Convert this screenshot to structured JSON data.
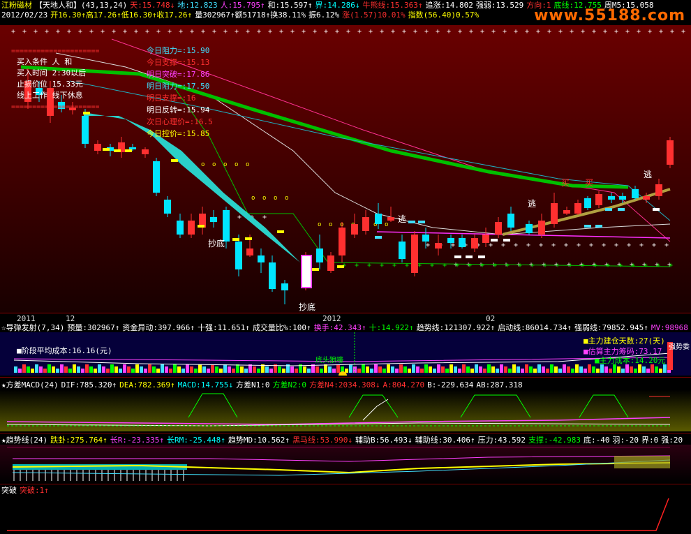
{
  "header": {
    "line1": [
      {
        "t": "江粉磁材",
        "c": "#ffff00"
      },
      {
        "t": "【天地人和】(43,13,24)",
        "c": "#ffffff"
      },
      {
        "t": "天:15.748↓",
        "c": "#ff3030"
      },
      {
        "t": "地:12.823",
        "c": "#40e0ff"
      },
      {
        "t": "人:15.795↑",
        "c": "#ff40ff"
      },
      {
        "t": "和:15.597↑",
        "c": "#ffffff"
      },
      {
        "t": "界:14.286↓",
        "c": "#00ffff"
      },
      {
        "t": "牛熊线:15.363↑",
        "c": "#ff3030"
      },
      {
        "t": "追涨:14.802",
        "c": "#ffffff"
      },
      {
        "t": "强弱:13.529",
        "c": "#ffffff"
      },
      {
        "t": "方向:1",
        "c": "#ff3030"
      },
      {
        "t": "底线:12.755",
        "c": "#00ff00"
      },
      {
        "t": "周M5:15.058",
        "c": "#ffffff"
      }
    ],
    "line2": [
      {
        "t": "2012/02/23",
        "c": "#ffffff"
      },
      {
        "t": "开16.30↑高17.26↑低16.30↑收17.26↑",
        "c": "#ffff00"
      },
      {
        "t": "量302967↑额51718↑换38.11%",
        "c": "#ffffff"
      },
      {
        "t": "振6.12%",
        "c": "#ffffff"
      },
      {
        "t": "涨(1.57)10.01%",
        "c": "#ff3030"
      },
      {
        "t": "指数(56.40)0.57%",
        "c": "#ffff00"
      }
    ]
  },
  "watermark": "www.55188.com",
  "main_chart": {
    "legend_left": [
      "买入条件  人 和",
      "买入时间  2:30以后",
      "止损价位  15.33元",
      "线上工作  线下休息"
    ],
    "legend_right": [
      {
        "t": "今日阻力=:15.90",
        "c": "#40e0ff"
      },
      {
        "t": "今日支撑=:15.13",
        "c": "#ff3030"
      },
      {
        "t": "明日突破=:17.86",
        "c": "#ff40ff"
      },
      {
        "t": "明日阻力=:17.50",
        "c": "#40e0ff"
      },
      {
        "t": "明日支撑=:16",
        "c": "#ff3030"
      },
      {
        "t": "明日反转=:15.94",
        "c": "#ffffff"
      },
      {
        "t": "次日心理价=:16.5",
        "c": "#ff3030"
      },
      {
        "t": "今日控价=:15.85",
        "c": "#ffff00"
      }
    ],
    "annotations": {
      "chaodi1": "抄底",
      "chaodi2": "抄底",
      "tao1": "逃",
      "tao2": "逃",
      "tao3": "逃",
      "mai1": "买",
      "mai2": "买"
    },
    "time_axis": [
      "2011",
      "12",
      "2012",
      "02"
    ]
  },
  "ind1": {
    "title": [
      {
        "t": "☆导弹发射(7,34)",
        "c": "#ffffff"
      },
      {
        "t": "预量:302967↑",
        "c": "#ffffff"
      },
      {
        "t": "资金异动:397.966↑",
        "c": "#ffffff"
      },
      {
        "t": "十强:11.651↑",
        "c": "#ffffff"
      },
      {
        "t": "成交量比%:100↑",
        "c": "#ffffff"
      },
      {
        "t": "换手:42.343↑",
        "c": "#ff40ff"
      },
      {
        "t": "十:14.922↑",
        "c": "#00ff00"
      },
      {
        "t": "趋势线:121307.922↑",
        "c": "#ffffff"
      },
      {
        "t": "启动线:86014.734↑",
        "c": "#ffffff"
      },
      {
        "t": "强弱线:79852.945↑",
        "c": "#ffffff"
      },
      {
        "t": "MV:98968",
        "c": "#ff40ff"
      }
    ],
    "avg_cost": "■阶段平均成本:16.16(元)",
    "right_labels": [
      {
        "t": "■主力建仓天数:27(天)",
        "c": "#ffff00"
      },
      {
        "t": "■估算主力筹码:73.17",
        "c": "#ff40ff"
      },
      {
        "t": "■主力成本:14.20元",
        "c": "#00ff00"
      }
    ],
    "side_text": "强势委",
    "center_text": "底头狼嚎"
  },
  "ind2": {
    "title": [
      {
        "t": "★方差MACD(24)",
        "c": "#ffffff"
      },
      {
        "t": "DIF:785.320↑",
        "c": "#ffffff"
      },
      {
        "t": "DEA:782.369↑",
        "c": "#ffff00"
      },
      {
        "t": "MACD:14.755↓",
        "c": "#00ffff"
      },
      {
        "t": "方差N1:0",
        "c": "#ffffff"
      },
      {
        "t": "方差N2:0",
        "c": "#00ff00"
      },
      {
        "t": "方差N4:2034.308↓",
        "c": "#ff3030"
      },
      {
        "t": "A:804.270",
        "c": "#ff3030"
      },
      {
        "t": "B:-229.634",
        "c": "#ffffff"
      },
      {
        "t": "AB:287.318",
        "c": "#ffffff"
      }
    ]
  },
  "ind3": {
    "title": [
      {
        "t": "★趋势线(24)",
        "c": "#ffffff"
      },
      {
        "t": "跌卦:275.764↑",
        "c": "#ffff00"
      },
      {
        "t": "长R:-23.335↑",
        "c": "#ff40ff"
      },
      {
        "t": "长RM:-25.448↑",
        "c": "#00ffff"
      },
      {
        "t": "趋势MD:10.562↑",
        "c": "#ffffff"
      },
      {
        "t": "黑马线:53.990↓",
        "c": "#ff3030"
      },
      {
        "t": "辅助B:56.493↓",
        "c": "#ffffff"
      },
      {
        "t": "辅助线:30.406↑",
        "c": "#ffffff"
      },
      {
        "t": "压力:43.592",
        "c": "#ffffff"
      },
      {
        "t": "支撑:-42.983",
        "c": "#00ff00"
      },
      {
        "t": "底:-40",
        "c": "#ffffff"
      },
      {
        "t": "羽:-20",
        "c": "#ffffff"
      },
      {
        "t": "界:0",
        "c": "#ffffff"
      },
      {
        "t": "强:20",
        "c": "#ffffff"
      }
    ]
  },
  "ind4": {
    "title": [
      {
        "t": "突破",
        "c": "#ffffff"
      },
      {
        "t": "突破:1↑",
        "c": "#ff3030"
      }
    ]
  },
  "colors": {
    "up": "#ff3030",
    "down": "#00e5ff",
    "bg_top": "#600000",
    "bg_bottom": "#1a0000"
  }
}
